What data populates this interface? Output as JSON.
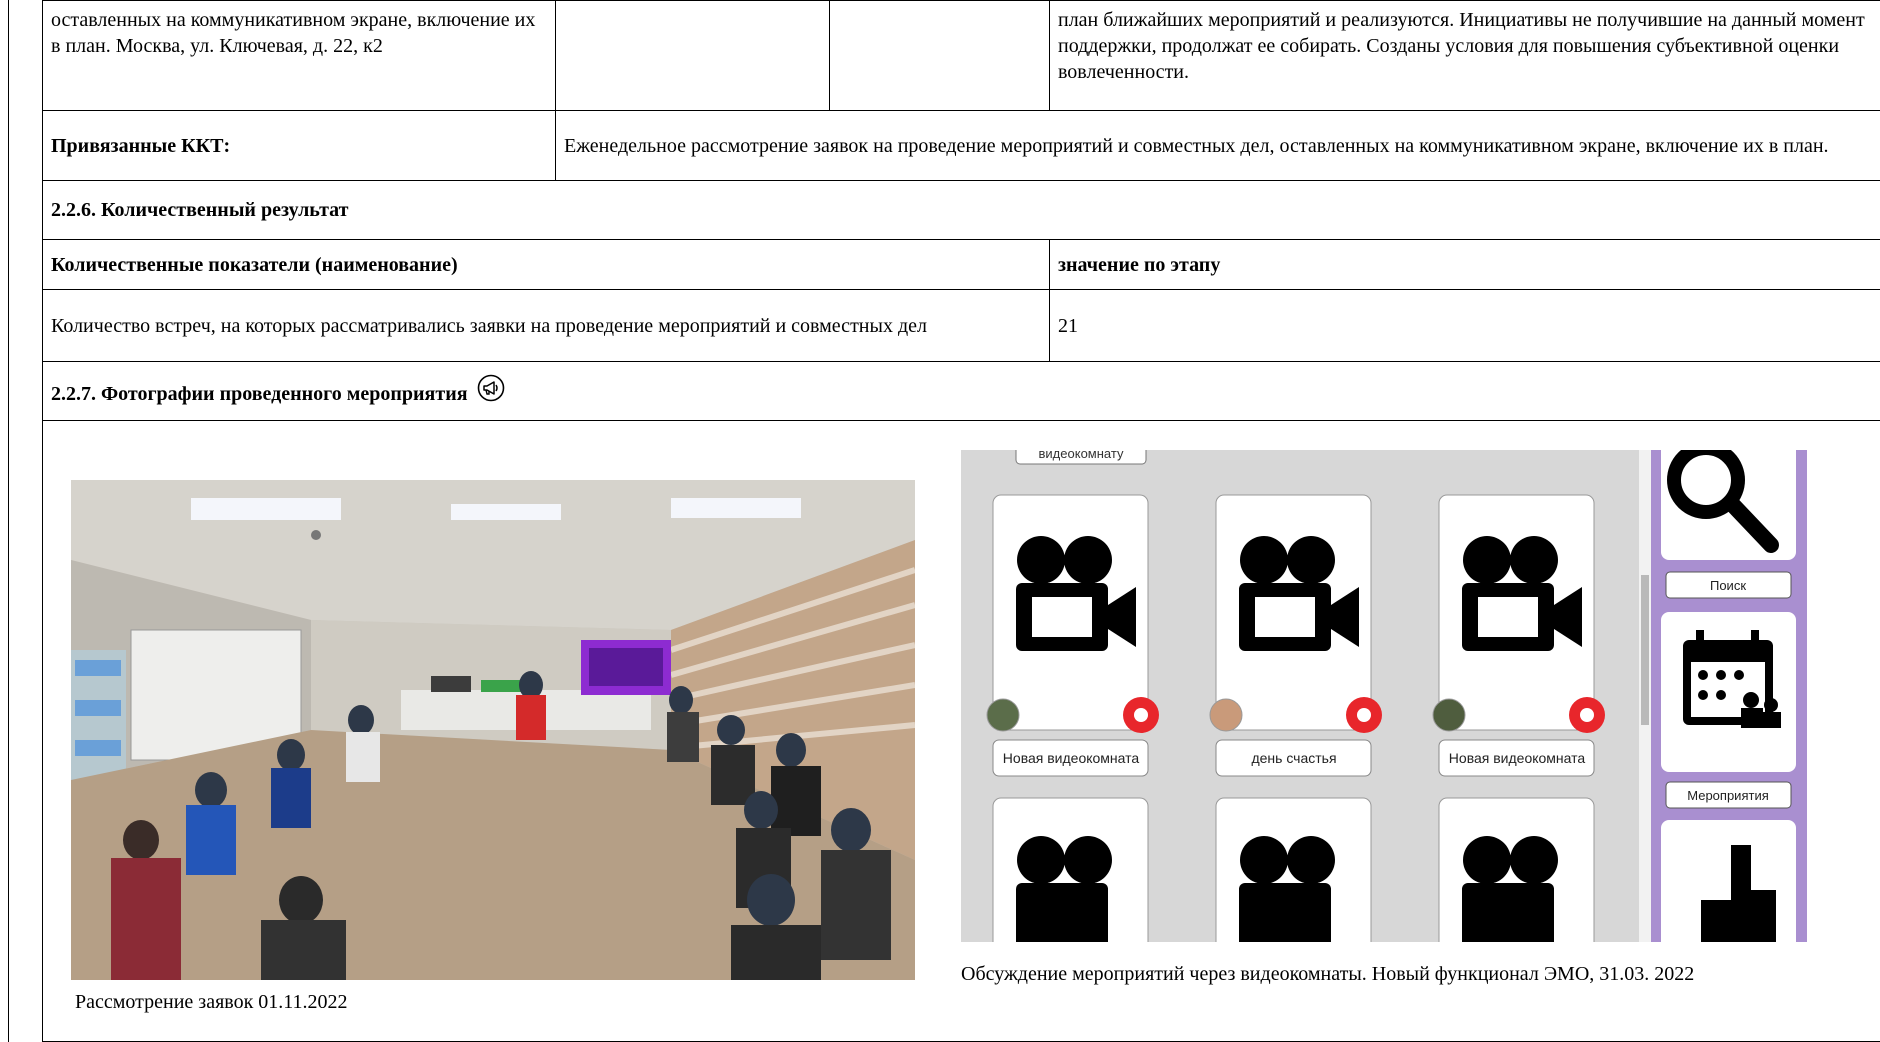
{
  "top_row": {
    "left_text": "оставленных на коммуникативном экране, включение их в план. Москва, ул. Ключевая, д. 22, к2",
    "right_text": "план ближайших мероприятий и реализуются. Инициативы не получившие на данный момент поддержки, продолжат ее собирать. Созданы условия для повышения субъективной оценки вовлеченности."
  },
  "linked_kkt": {
    "label": "Привязанные ККТ:",
    "value": "Еженедельное рассмотрение заявок на проведение мероприятий и совместных дел, оставленных на коммуникативном экране, включение их в план."
  },
  "section_226": {
    "title": "2.2.6. Количественный результат"
  },
  "quant_table": {
    "header_name": "Количественные показатели (наименование)",
    "header_value": "значение по этапу",
    "row_name": "Количество встреч, на которых рассматривались заявки на проведение мероприятий и совместных дел",
    "row_value": "21"
  },
  "section_227": {
    "title": "2.2.7. Фотографии проведенного мероприятия",
    "icon": "megaphone-icon"
  },
  "photos": {
    "caption_1": "Рассмотрение заявок 01.11.2022",
    "caption_2": "Обсуждение мероприятий через видеокомнаты. Новый функционал ЭМО, 31.03. 2022",
    "screen": {
      "top_partial_label": "видеокомнату",
      "tile_labels": [
        "Новая видеокомната",
        "день счастья",
        "Новая видеокомната"
      ],
      "side_labels": [
        "Поиск",
        "Мероприятия"
      ]
    }
  }
}
